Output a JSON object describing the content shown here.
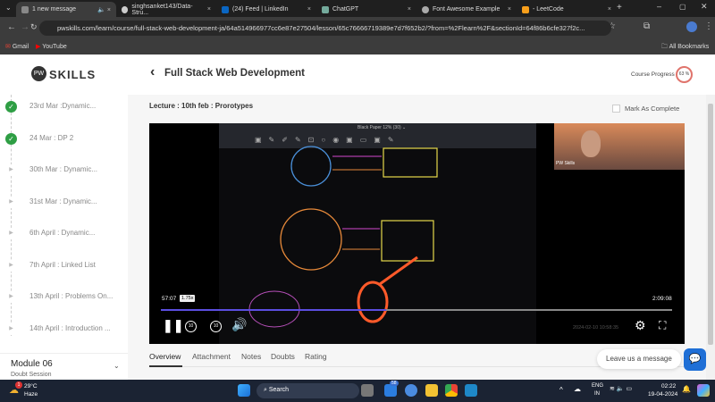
{
  "browser": {
    "tabs": [
      {
        "label": "1 new message",
        "active": true
      },
      {
        "label": "singhsanket143/Data-Stru..."
      },
      {
        "label": "(24) Feed | LinkedIn"
      },
      {
        "label": "ChatGPT"
      },
      {
        "label": "Font Awesome Example"
      },
      {
        "label": "- LeetCode"
      }
    ],
    "url": "pwskills.com/learn/course/full-stack-web-development-ja/64a514966977cc6e87e27504/lesson/65c76666719389e7d7f652b2/?from=%2Flearn%2F&sectionId=64f86b6cfe327f2c...",
    "bookmarks": [
      "Gmail",
      "YouTube"
    ],
    "all_bookmarks": "All Bookmarks"
  },
  "header": {
    "logo": "SKILLS",
    "back": "‹",
    "title": "Full Stack Web Development",
    "progress_label": "Course Progress",
    "progress_value": "63 %",
    "progress_percent": 63
  },
  "sidebar": {
    "items": [
      {
        "label": "23rd Mar :Dynamic...",
        "done": true
      },
      {
        "label": "24 Mar : DP 2",
        "done": true
      },
      {
        "label": "30th Mar : Dynamic...",
        "done": false
      },
      {
        "label": "31st Mar : Dynamic...",
        "done": false
      },
      {
        "label": "6th April : Dynamic...",
        "done": false
      },
      {
        "label": "7th April : Linked List",
        "done": false
      },
      {
        "label": "13th April : Problems On...",
        "done": false
      },
      {
        "label": "14th April : Introduction ...",
        "done": false
      }
    ],
    "module_title": "Module 06",
    "module_sub": "Doubt Session"
  },
  "lecture": {
    "title": "Lecture : 10th feb : Prorotypes",
    "mark_complete": "Mark As Complete"
  },
  "player": {
    "current": "57:07",
    "speed": "1.75x",
    "duration": "2:09:08",
    "progress_fraction": 0.44,
    "timestamp": "2024-02-10 10:58:35",
    "webcam_name": "PW Skills",
    "board_title": "Black Paper  12% (30) ⌄",
    "rewind": "10",
    "forward": "10"
  },
  "page_tabs": [
    "Overview",
    "Attachment",
    "Notes",
    "Doubts",
    "Rating"
  ],
  "chat": {
    "label": "Leave us a message"
  },
  "taskbar": {
    "temp": "29°C",
    "weather": "Haze",
    "search": "Search",
    "lang1": "ENG",
    "lang2": "IN",
    "time": "02:22",
    "date": "19-04-2024",
    "badge": "1",
    "notif": "58"
  }
}
